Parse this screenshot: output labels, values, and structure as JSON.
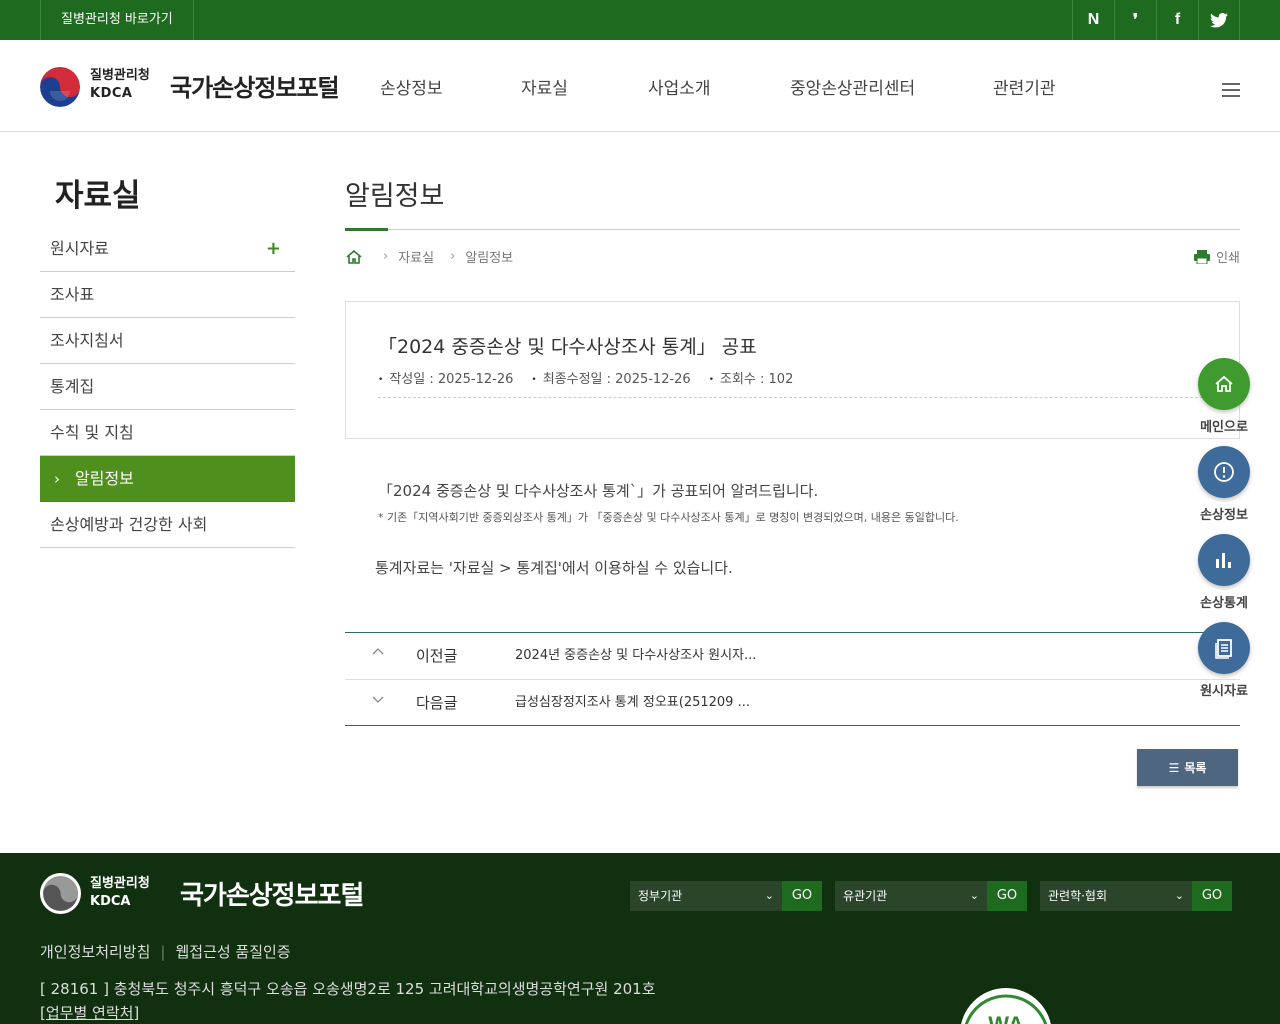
{
  "topbar": {
    "shortcut": "질병관리청 바로가기",
    "sns": [
      "N",
      "❜",
      "f",
      "🐦"
    ]
  },
  "header": {
    "org_kr": "질병관리청",
    "org_en": "KDCA",
    "site_title": "국가손상정보포털",
    "gnb": [
      "손상정보",
      "자료실",
      "사업소개",
      "중앙손상관리센터",
      "관련기관"
    ]
  },
  "sidebar": {
    "title": "자료실",
    "items": [
      {
        "label": "원시자료",
        "plus": "+"
      },
      {
        "label": "조사표"
      },
      {
        "label": "조사지침서"
      },
      {
        "label": "통계집"
      },
      {
        "label": "수칙 및 지침"
      },
      {
        "label": "알림정보"
      },
      {
        "label": "손상예방과 건강한 사회"
      }
    ]
  },
  "content": {
    "page_title": "알림정보",
    "breadcrumb": [
      "자료실",
      "알림정보"
    ],
    "print_label": "인쇄",
    "post": {
      "title": "「2024 중증손상 및 다수사상조사 통계」 공표",
      "meta": [
        "작성일 : 2025-12-26",
        "최종수정일 : 2025-12-26",
        "조회수 : 102"
      ]
    },
    "body": [
      "「2024 중증손상 및 다수사상조사 통계`」가 공표되어 알려드립니다.",
      "* 기존「지역사회기반 중증외상조사 통계」가 「중증손상 및 다수사상조사 통계」로 명칭이 변경되었으며, 내용은 동일합니다.",
      "통계자료는 '자료실 > 통계집'에서 이용하실 수 있습니다."
    ],
    "prev": {
      "label": "이전글",
      "title": "2024년 중증손상 및 다수사상조사 원시자..."
    },
    "next": {
      "label": "다음글",
      "title": "급성심장정지조사 통계 정오표(251209 ..."
    },
    "list_button": "목록"
  },
  "quick_menu": [
    "메인으로",
    "손상정보",
    "손상통계",
    "원시자료"
  ],
  "footer": {
    "org_kr": "질병관리청",
    "org_en": "KDCA",
    "site_title": "국가손상정보포털",
    "selects": [
      {
        "label": "정부기관",
        "go": "GO"
      },
      {
        "label": "유관기관",
        "go": "GO"
      },
      {
        "label": "관련학·협회",
        "go": "GO"
      }
    ],
    "links": [
      "개인정보처리방침",
      "웹접근성 품질인증"
    ],
    "address": "[ 28161 ] 충청북도 청주시 흥덕구 오송읍 오송생명2로 125 고려대학교의생명공학연구원 201호",
    "contact": "[업무별 연락처]"
  },
  "colors": {
    "top_green": "#1e6a1e",
    "active_green": "#4f8f1e",
    "footer_bg": "#103010",
    "quick_green": "#3f9a2f",
    "quick_blue": "#3f6b9a"
  }
}
